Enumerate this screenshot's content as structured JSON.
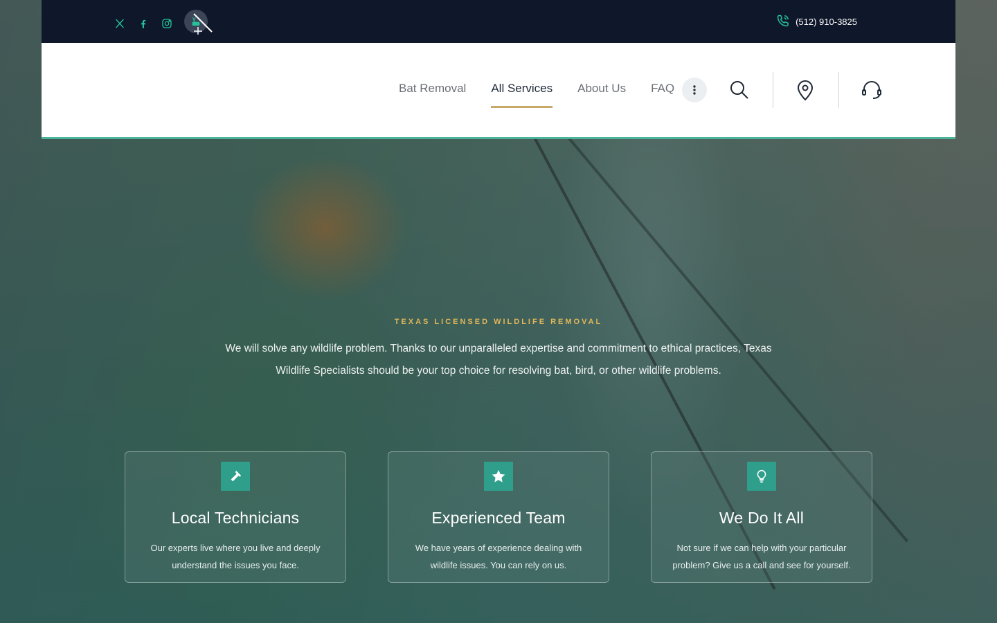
{
  "topbar": {
    "social": [
      {
        "name": "x-icon"
      },
      {
        "name": "facebook-icon"
      },
      {
        "name": "instagram-icon"
      },
      {
        "name": "youtube-icon"
      }
    ],
    "phone": "(512) 910-3825"
  },
  "nav": {
    "items": [
      {
        "label": "Bat Removal"
      },
      {
        "label": "All Services",
        "active": true
      },
      {
        "label": "About Us"
      },
      {
        "label": "FAQ"
      }
    ]
  },
  "hero": {
    "kicker": "TEXAS LICENSED WILDLIFE REMOVAL",
    "intro": "We will solve any wildlife problem. Thanks to our unparalleled expertise and commitment to ethical practices, Texas Wildlife Specialists should be your top choice for resolving bat, bird, or other wildlife problems."
  },
  "features": [
    {
      "icon": "hammer-icon",
      "title": "Local Technicians",
      "text": "Our experts live where you live and deeply understand the issues you face."
    },
    {
      "icon": "star-icon",
      "title": "Experienced Team",
      "text": "We have years of experience dealing with wildlife issues. You can rely on us."
    },
    {
      "icon": "lightbulb-icon",
      "title": "We Do It All",
      "text": "Not sure if we can help with your particular problem? Give us a call and see for yourself."
    }
  ],
  "colors": {
    "topbar_bg": "#0f172a",
    "social": "#25c29a",
    "accent_underline": "#c8a96a",
    "header_border": "#4bb39a",
    "badge": "#2f9e8a",
    "kicker": "#e1b75a"
  }
}
